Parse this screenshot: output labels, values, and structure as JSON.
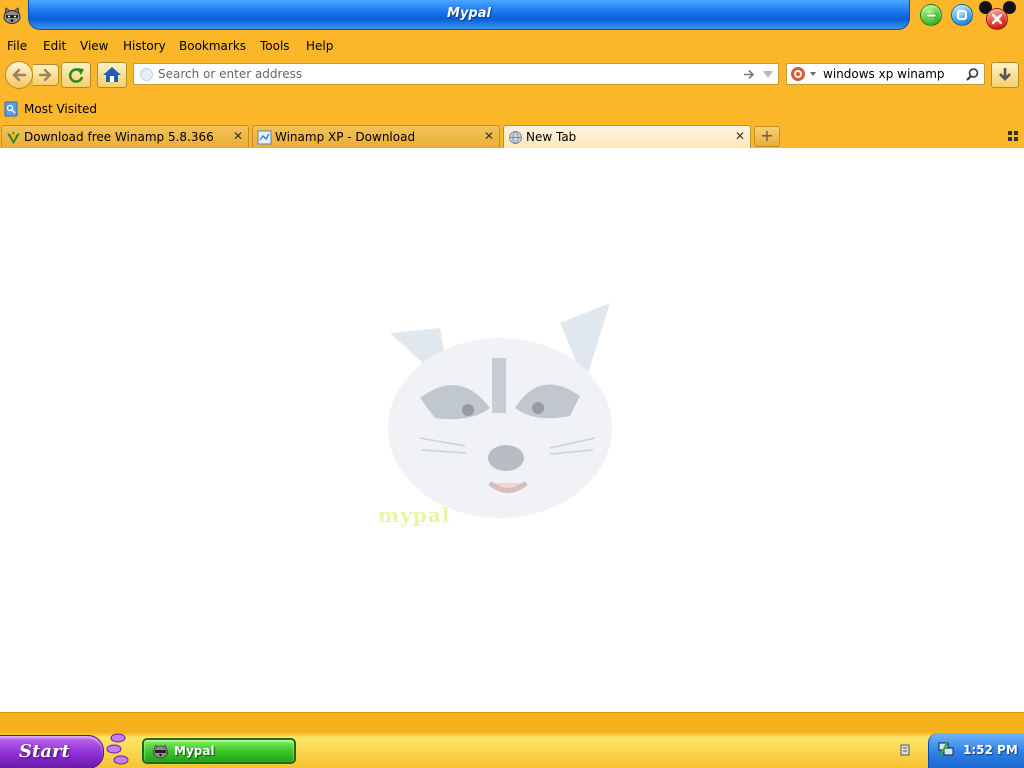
{
  "window": {
    "title": "Mypal",
    "controls": {
      "minimize": "minimize",
      "restore": "restore",
      "close": "close"
    }
  },
  "menu": {
    "items": [
      {
        "label": "File"
      },
      {
        "label": "Edit"
      },
      {
        "label": "View"
      },
      {
        "label": "History"
      },
      {
        "label": "Bookmarks"
      },
      {
        "label": "Tools"
      },
      {
        "label": "Help"
      }
    ]
  },
  "navbar": {
    "url_placeholder": "Search or enter address",
    "url_value": "",
    "search_value": "windows xp winamp"
  },
  "bookmarks": {
    "most_visited": "Most Visited"
  },
  "tabs": [
    {
      "label": "Download free Winamp 5.8.366",
      "icon": "winamp-icon",
      "active": false
    },
    {
      "label": "Winamp XP - Download",
      "icon": "page-icon",
      "active": false
    },
    {
      "label": "New Tab",
      "icon": "globe-icon",
      "active": true
    }
  ],
  "content": {
    "watermark_text": "mypal"
  },
  "taskbar": {
    "start_label": "Start",
    "task_label": "Mypal",
    "clock": "1:52 PM"
  },
  "colors": {
    "chrome": "#fbb62a",
    "title_blue": "#1e7df2",
    "start_purple": "#8a2bd1",
    "task_green": "#3cc22b",
    "tray_blue": "#2d7fe6"
  }
}
